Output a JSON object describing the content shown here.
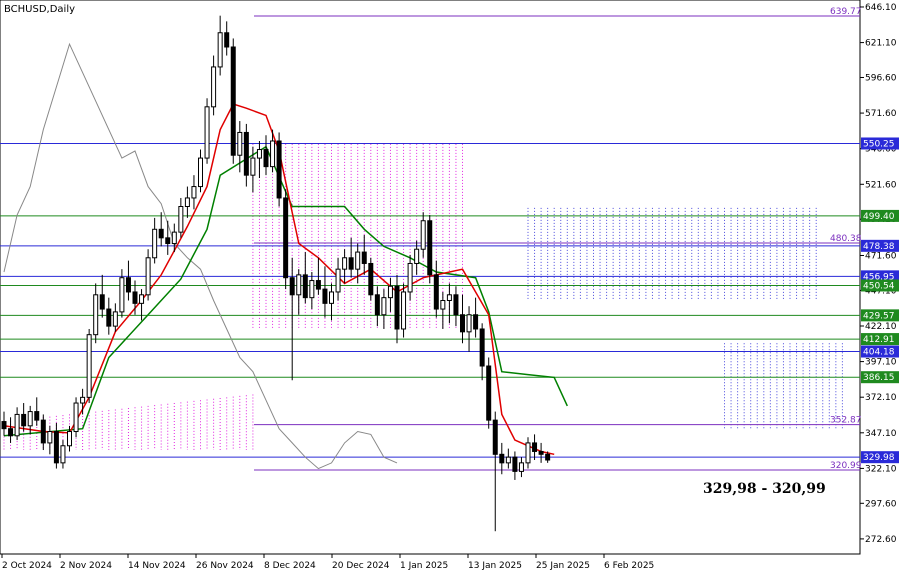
{
  "chart_data": {
    "type": "candlestick",
    "title": "BCHUSD,Daily",
    "ylim": [
      262,
      651
    ],
    "y_ticks": [
      "646.10",
      "621.10",
      "596.60",
      "571.60",
      "546.60",
      "521.60",
      "497.10",
      "471.60",
      "447.10",
      "422.10",
      "397.10",
      "372.10",
      "347.10",
      "322.10",
      "297.60",
      "272.60"
    ],
    "x_labels": [
      "2 Oct 2024",
      "2 Nov 2024",
      "14 Nov 2024",
      "26 Nov 2024",
      "8 Dec 2024",
      "20 Dec 2024",
      "1 Jan 2025",
      "13 Jan 2025",
      "25 Jan 2025",
      "6 Feb 2025"
    ],
    "horizontal_levels": [
      {
        "value": 639.77,
        "label": "639.77",
        "color": "#7b2fbf",
        "badge": false
      },
      {
        "value": 550.25,
        "label": "550.25",
        "color": "#2a2ad8",
        "badge": true
      },
      {
        "value": 499.4,
        "label": "499.40",
        "color": "#1f8a1f",
        "badge": true
      },
      {
        "value": 480.38,
        "label": "480.38",
        "color": "#7b2fbf",
        "badge": false
      },
      {
        "value": 478.38,
        "label": "478.38",
        "color": "#2a2ad8",
        "badge": true
      },
      {
        "value": 456.95,
        "label": "456.95",
        "color": "#2a2ad8",
        "badge": true
      },
      {
        "value": 450.54,
        "label": "450.54",
        "color": "#1f8a1f",
        "badge": true
      },
      {
        "value": 429.57,
        "label": "429.57",
        "color": "#1f8a1f",
        "badge": true
      },
      {
        "value": 412.91,
        "label": "412.91",
        "color": "#1f8a1f",
        "badge": true
      },
      {
        "value": 404.18,
        "label": "404.18",
        "color": "#2a2ad8",
        "badge": true
      },
      {
        "value": 386.15,
        "label": "386.15",
        "color": "#1f8a1f",
        "badge": true
      },
      {
        "value": 352.87,
        "label": "352.87",
        "color": "#7b2fbf",
        "badge": false
      },
      {
        "value": 329.98,
        "label": "329.98",
        "color": "#2a2ad8",
        "badge": true
      },
      {
        "value": 320.99,
        "label": "320.99",
        "color": "#7b2fbf",
        "badge": false
      }
    ],
    "annotation": "329,98 - 320,99",
    "candles": [
      [
        355,
        362,
        345,
        350
      ],
      [
        350,
        358,
        340,
        345
      ],
      [
        345,
        365,
        342,
        360
      ],
      [
        360,
        368,
        348,
        352
      ],
      [
        352,
        366,
        346,
        362
      ],
      [
        362,
        372,
        352,
        356
      ],
      [
        356,
        360,
        335,
        340
      ],
      [
        340,
        352,
        332,
        348
      ],
      [
        348,
        354,
        322,
        326
      ],
      [
        326,
        342,
        322,
        338
      ],
      [
        338,
        352,
        334,
        348
      ],
      [
        348,
        372,
        344,
        368
      ],
      [
        368,
        378,
        360,
        372
      ],
      [
        372,
        420,
        368,
        416
      ],
      [
        416,
        452,
        410,
        444
      ],
      [
        444,
        458,
        428,
        434
      ],
      [
        434,
        442,
        416,
        422
      ],
      [
        422,
        438,
        418,
        432
      ],
      [
        432,
        462,
        428,
        456
      ],
      [
        456,
        468,
        440,
        446
      ],
      [
        446,
        454,
        430,
        438
      ],
      [
        438,
        448,
        426,
        444
      ],
      [
        444,
        476,
        440,
        470
      ],
      [
        470,
        498,
        466,
        490
      ],
      [
        490,
        502,
        478,
        484
      ],
      [
        484,
        496,
        472,
        480
      ],
      [
        480,
        494,
        474,
        488
      ],
      [
        488,
        512,
        484,
        506
      ],
      [
        506,
        520,
        498,
        512
      ],
      [
        512,
        528,
        504,
        520
      ],
      [
        520,
        546,
        516,
        540
      ],
      [
        540,
        582,
        536,
        576
      ],
      [
        576,
        612,
        570,
        604
      ],
      [
        604,
        640,
        598,
        628
      ],
      [
        628,
        636,
        612,
        618
      ],
      [
        618,
        624,
        536,
        542
      ],
      [
        542,
        566,
        530,
        558
      ],
      [
        558,
        564,
        520,
        528
      ],
      [
        528,
        548,
        516,
        540
      ],
      [
        540,
        552,
        526,
        546
      ],
      [
        546,
        556,
        528,
        534
      ],
      [
        534,
        560,
        530,
        552
      ],
      [
        552,
        558,
        506,
        512
      ],
      [
        512,
        518,
        448,
        456
      ],
      [
        456,
        470,
        384,
        444
      ],
      [
        444,
        462,
        430,
        458
      ],
      [
        458,
        474,
        438,
        442
      ],
      [
        442,
        460,
        434,
        454
      ],
      [
        454,
        470,
        444,
        448
      ],
      [
        448,
        464,
        428,
        438
      ],
      [
        438,
        452,
        426,
        446
      ],
      [
        446,
        470,
        440,
        462
      ],
      [
        462,
        476,
        452,
        470
      ],
      [
        470,
        484,
        456,
        462
      ],
      [
        462,
        480,
        452,
        474
      ],
      [
        474,
        486,
        458,
        466
      ],
      [
        466,
        470,
        440,
        444
      ],
      [
        444,
        450,
        422,
        430
      ],
      [
        430,
        448,
        420,
        442
      ],
      [
        442,
        456,
        432,
        450
      ],
      [
        450,
        458,
        410,
        420
      ],
      [
        420,
        452,
        414,
        446
      ],
      [
        446,
        472,
        440,
        466
      ],
      [
        466,
        482,
        458,
        476
      ],
      [
        476,
        502,
        470,
        496
      ],
      [
        496,
        500,
        452,
        458
      ],
      [
        458,
        468,
        428,
        434
      ],
      [
        434,
        446,
        420,
        440
      ],
      [
        440,
        452,
        424,
        444
      ],
      [
        444,
        450,
        422,
        430
      ],
      [
        430,
        444,
        410,
        418
      ],
      [
        418,
        436,
        404,
        430
      ],
      [
        430,
        442,
        414,
        420
      ],
      [
        420,
        424,
        384,
        394
      ],
      [
        394,
        400,
        350,
        356
      ],
      [
        356,
        362,
        278,
        332
      ],
      [
        332,
        340,
        318,
        326
      ],
      [
        326,
        336,
        322,
        330
      ],
      [
        330,
        334,
        314,
        320
      ],
      [
        320,
        330,
        316,
        326
      ],
      [
        326,
        344,
        322,
        340
      ],
      [
        340,
        346,
        328,
        334
      ],
      [
        334,
        340,
        326,
        332
      ],
      [
        332,
        334,
        326,
        328
      ]
    ],
    "tenkan_sen": [
      [
        0,
        352
      ],
      [
        6,
        348
      ],
      [
        10,
        347
      ],
      [
        13,
        372
      ],
      [
        17,
        418
      ],
      [
        21,
        440
      ],
      [
        24,
        458
      ],
      [
        28,
        492
      ],
      [
        31,
        520
      ],
      [
        33,
        560
      ],
      [
        35,
        578
      ],
      [
        37,
        575
      ],
      [
        40,
        570
      ],
      [
        42,
        545
      ],
      [
        45,
        480
      ],
      [
        48,
        470
      ],
      [
        52,
        452
      ],
      [
        56,
        462
      ],
      [
        60,
        446
      ],
      [
        64,
        456
      ],
      [
        66,
        458
      ],
      [
        70,
        462
      ],
      [
        74,
        430
      ],
      [
        76,
        360
      ],
      [
        78,
        342
      ],
      [
        80,
        338
      ],
      [
        82,
        334
      ],
      [
        84,
        332
      ]
    ],
    "kijun_sen": [
      [
        0,
        345
      ],
      [
        12,
        350
      ],
      [
        16,
        400
      ],
      [
        22,
        430
      ],
      [
        27,
        455
      ],
      [
        31,
        490
      ],
      [
        33,
        528
      ],
      [
        40,
        548
      ],
      [
        44,
        506
      ],
      [
        52,
        506
      ],
      [
        55,
        490
      ],
      [
        58,
        478
      ],
      [
        62,
        470
      ],
      [
        64,
        465
      ],
      [
        66,
        460
      ],
      [
        72,
        456
      ],
      [
        74,
        432
      ],
      [
        76,
        390
      ],
      [
        80,
        388
      ],
      [
        84,
        386
      ],
      [
        86,
        366
      ]
    ],
    "chikou_span": [
      [
        0,
        460
      ],
      [
        2,
        500
      ],
      [
        4,
        520
      ],
      [
        6,
        560
      ],
      [
        8,
        590
      ],
      [
        10,
        620
      ],
      [
        12,
        600
      ],
      [
        14,
        580
      ],
      [
        16,
        560
      ],
      [
        18,
        540
      ],
      [
        20,
        545
      ],
      [
        22,
        520
      ],
      [
        24,
        508
      ],
      [
        26,
        480
      ],
      [
        28,
        470
      ],
      [
        30,
        462
      ],
      [
        32,
        440
      ],
      [
        34,
        420
      ],
      [
        36,
        400
      ],
      [
        38,
        390
      ],
      [
        40,
        370
      ],
      [
        42,
        350
      ],
      [
        44,
        340
      ],
      [
        46,
        330
      ],
      [
        48,
        322
      ],
      [
        50,
        326
      ],
      [
        52,
        340
      ],
      [
        54,
        348
      ],
      [
        56,
        346
      ],
      [
        58,
        330
      ],
      [
        60,
        326
      ]
    ],
    "tenkan_line_color": "#e00000",
    "kijun_line_color": "#008000",
    "chikou_line_color": "#888888",
    "cloud_bull_color": "#dd00dd",
    "cloud_bear_color": "#2a2ad8"
  }
}
